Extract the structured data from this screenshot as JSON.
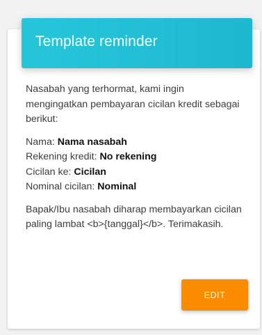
{
  "card": {
    "title": "Template reminder",
    "intro": "Nasabah yang terhormat, kami ingin mengingatkan pembayaran cicilan kredit sebagai berikut:",
    "details": [
      {
        "label": "Nama: ",
        "value": "Nama nasabah"
      },
      {
        "label": "Rekening kredit: ",
        "value": "No rekening"
      },
      {
        "label": "Cicilan ke: ",
        "value": "Cicilan"
      },
      {
        "label": "Nominal cicilan: ",
        "value": "Nominal"
      }
    ],
    "closing": "Bapak/Ibu nasabah diharap membayarkan cicilan paling lambat <b>{tanggal}</b>. Terimakasih.",
    "edit_label": "EDIT"
  },
  "colors": {
    "header_bg": "#26c6da",
    "button_bg": "#fb8c00",
    "page_bg": "#f2f2f2",
    "card_bg": "#ffffff"
  }
}
